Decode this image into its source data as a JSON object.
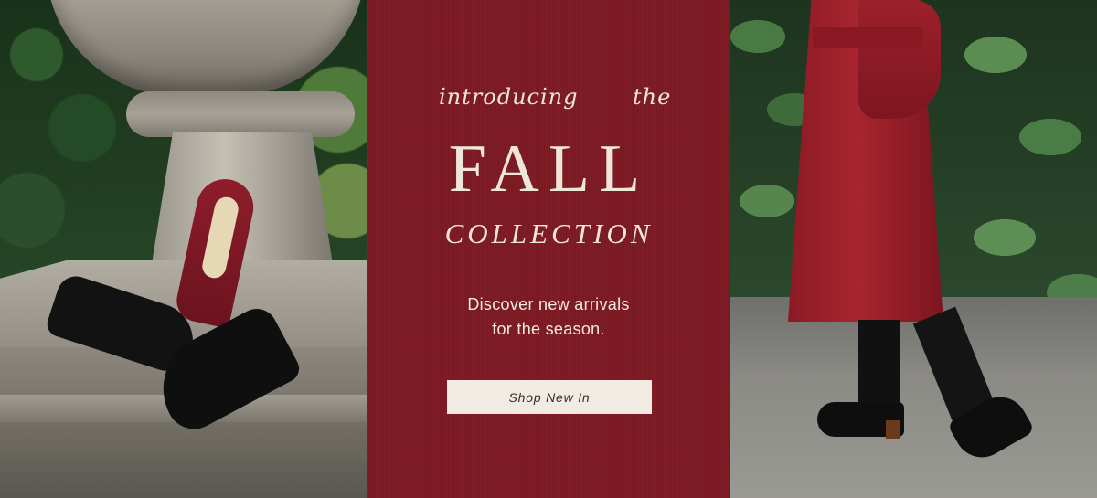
{
  "banner": {
    "intro_word_1": "introducing",
    "intro_word_2": "the",
    "title": "FALL",
    "subtitle": "COLLECTION",
    "description_line_1": "Discover new arrivals",
    "description_line_2": "for the season.",
    "cta_label": "Shop New In"
  },
  "colors": {
    "panel_background": "#7c1a24",
    "headline_text": "#efe6da",
    "cta_background": "#f1ebe3",
    "cta_text": "#3a2a24"
  }
}
